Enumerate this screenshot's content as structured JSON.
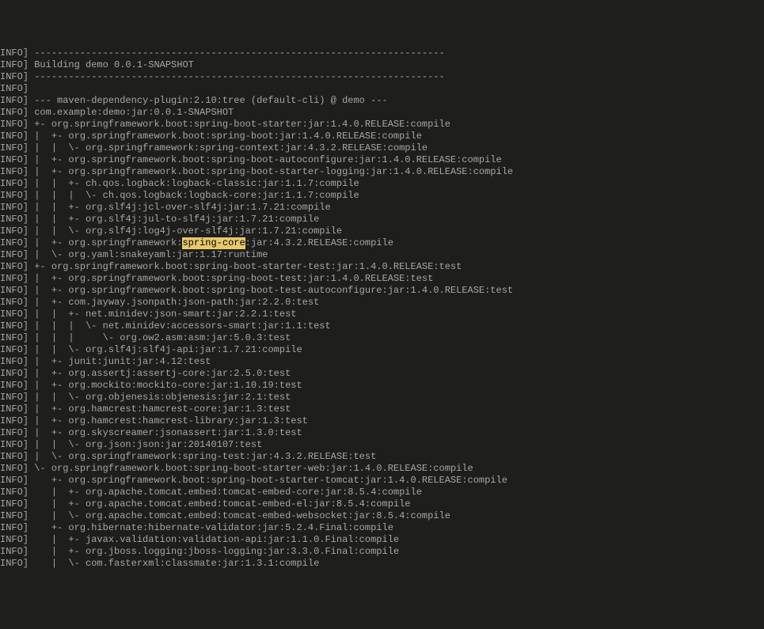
{
  "prefix": "INFO]",
  "highlighted_text": "spring-core",
  "lines": [
    " ------------------------------------------------------------------------",
    " Building demo 0.0.1-SNAPSHOT",
    " ------------------------------------------------------------------------",
    "",
    " --- maven-dependency-plugin:2.10:tree (default-cli) @ demo ---",
    " com.example:demo:jar:0.0.1-SNAPSHOT",
    " +- org.springframework.boot:spring-boot-starter:jar:1.4.0.RELEASE:compile",
    " |  +- org.springframework.boot:spring-boot:jar:1.4.0.RELEASE:compile",
    " |  |  \\- org.springframework:spring-context:jar:4.3.2.RELEASE:compile",
    " |  +- org.springframework.boot:spring-boot-autoconfigure:jar:1.4.0.RELEASE:compile",
    " |  +- org.springframework.boot:spring-boot-starter-logging:jar:1.4.0.RELEASE:compile",
    " |  |  +- ch.qos.logback:logback-classic:jar:1.1.7:compile",
    " |  |  |  \\- ch.qos.logback:logback-core:jar:1.1.7:compile",
    " |  |  +- org.slf4j:jcl-over-slf4j:jar:1.7.21:compile",
    " |  |  +- org.slf4j:jul-to-slf4j:jar:1.7.21:compile",
    " |  |  \\- org.slf4j:log4j-over-slf4j:jar:1.7.21:compile",
    " |  +- org.springframework:__HIGHLIGHT__:jar:4.3.2.RELEASE:compile",
    " |  \\- org.yaml:snakeyaml:jar:1.17:runtime",
    " +- org.springframework.boot:spring-boot-starter-test:jar:1.4.0.RELEASE:test",
    " |  +- org.springframework.boot:spring-boot-test:jar:1.4.0.RELEASE:test",
    " |  +- org.springframework.boot:spring-boot-test-autoconfigure:jar:1.4.0.RELEASE:test",
    " |  +- com.jayway.jsonpath:json-path:jar:2.2.0:test",
    " |  |  +- net.minidev:json-smart:jar:2.2.1:test",
    " |  |  |  \\- net.minidev:accessors-smart:jar:1.1:test",
    " |  |  |     \\- org.ow2.asm:asm:jar:5.0.3:test",
    " |  |  \\- org.slf4j:slf4j-api:jar:1.7.21:compile",
    " |  +- junit:junit:jar:4.12:test",
    " |  +- org.assertj:assertj-core:jar:2.5.0:test",
    " |  +- org.mockito:mockito-core:jar:1.10.19:test",
    " |  |  \\- org.objenesis:objenesis:jar:2.1:test",
    " |  +- org.hamcrest:hamcrest-core:jar:1.3:test",
    " |  +- org.hamcrest:hamcrest-library:jar:1.3:test",
    " |  +- org.skyscreamer:jsonassert:jar:1.3.0:test",
    " |  |  \\- org.json:json:jar:20140107:test",
    " |  \\- org.springframework:spring-test:jar:4.3.2.RELEASE:test",
    " \\- org.springframework.boot:spring-boot-starter-web:jar:1.4.0.RELEASE:compile",
    "    +- org.springframework.boot:spring-boot-starter-tomcat:jar:1.4.0.RELEASE:compile",
    "    |  +- org.apache.tomcat.embed:tomcat-embed-core:jar:8.5.4:compile",
    "    |  +- org.apache.tomcat.embed:tomcat-embed-el:jar:8.5.4:compile",
    "    |  \\- org.apache.tomcat.embed:tomcat-embed-websocket:jar:8.5.4:compile",
    "    +- org.hibernate:hibernate-validator:jar:5.2.4.Final:compile",
    "    |  +- javax.validation:validation-api:jar:1.1.0.Final:compile",
    "    |  +- org.jboss.logging:jboss-logging:jar:3.3.0.Final:compile",
    "    |  \\- com.fasterxml:classmate:jar:1.3.1:compile"
  ]
}
